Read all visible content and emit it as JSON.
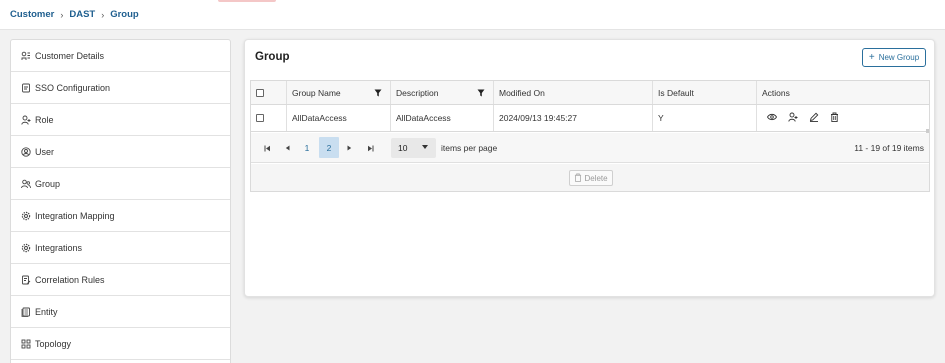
{
  "breadcrumb": [
    "Customer",
    "DAST",
    "Group"
  ],
  "sidebar": {
    "items": [
      {
        "label": "Customer Details",
        "icon": "customer-details-icon"
      },
      {
        "label": "SSO Configuration",
        "icon": "sso-icon"
      },
      {
        "label": "Role",
        "icon": "role-icon"
      },
      {
        "label": "User",
        "icon": "user-icon"
      },
      {
        "label": "Group",
        "icon": "group-icon",
        "active": true
      },
      {
        "label": "Integration Mapping",
        "icon": "gear-icon"
      },
      {
        "label": "Integrations",
        "icon": "gear-icon"
      },
      {
        "label": "Correlation Rules",
        "icon": "rules-icon"
      },
      {
        "label": "Entity",
        "icon": "entity-icon"
      },
      {
        "label": "Topology",
        "icon": "topology-icon"
      }
    ]
  },
  "panel": {
    "title": "Group",
    "new_button": "New Group"
  },
  "table": {
    "columns": [
      "Group Name",
      "Description",
      "Modified On",
      "Is Default",
      "Actions"
    ],
    "rows": [
      {
        "group_name": "AllDataAccess",
        "description": "AllDataAccess",
        "modified_on": "2024/09/13 19:45:27",
        "is_default": "Y"
      }
    ]
  },
  "pager": {
    "pages": [
      "1",
      "2"
    ],
    "current_page": "2",
    "page_size": "10",
    "page_size_label": "items per page",
    "info": "11 - 19 of 19 items"
  },
  "delete_button": "Delete",
  "colors": {
    "accent": "#2a6f9c",
    "active_page": "#c9def0"
  }
}
